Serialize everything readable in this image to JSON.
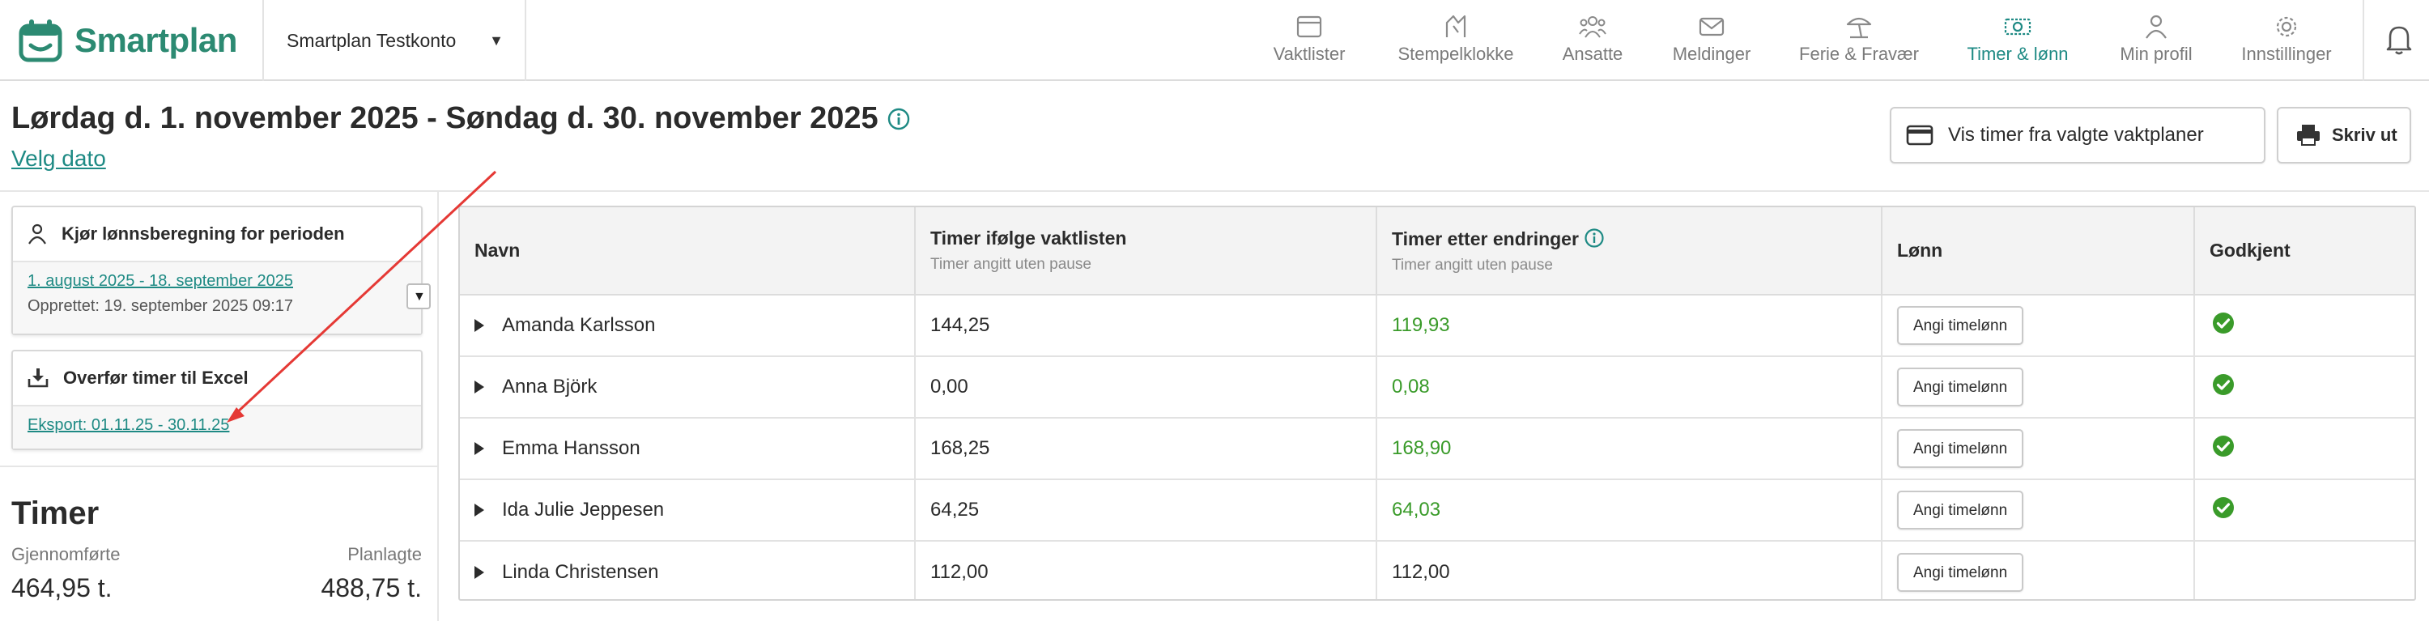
{
  "brand": {
    "name": "Smartplan",
    "color": "#2c8a72"
  },
  "account": {
    "name": "Smartplan Testkonto"
  },
  "nav": {
    "items": [
      {
        "label": "Vaktlister",
        "icon": "calendar-icon"
      },
      {
        "label": "Stempelklokke",
        "icon": "stamp-clock-icon"
      },
      {
        "label": "Ansatte",
        "icon": "people-icon"
      },
      {
        "label": "Meldinger",
        "icon": "envelope-icon"
      },
      {
        "label": "Ferie & Fravær",
        "icon": "beach-umbrella-icon"
      },
      {
        "label": "Timer & lønn",
        "icon": "money-icon"
      },
      {
        "label": "Min profil",
        "icon": "user-icon"
      },
      {
        "label": "Innstillinger",
        "icon": "gear-icon"
      }
    ],
    "active": "Timer & lønn",
    "active_color": "#1e8a84"
  },
  "header": {
    "title": "Lørdag d. 1. november 2025 - Søndag d. 30. november 2025",
    "velg_dato": "Velg dato",
    "vis_timer_button": "Vis timer fra valgte vaktplaner",
    "skriv_ut_button": "Skriv ut"
  },
  "left": {
    "payroll_card": {
      "title": "Kjør lønnsberegning for perioden",
      "period_link": "1. august 2025 - 18. september 2025",
      "created": "Opprettet: 19. september 2025 09:17"
    },
    "excel_card": {
      "title": "Overfør timer til Excel",
      "export_link": "Eksport: 01.11.25 - 30.11.25"
    },
    "timer": {
      "heading": "Timer",
      "completed_label": "Gjennomførte",
      "planned_label": "Planlagte",
      "completed_value": "464,95 t.",
      "planned_value": "488,75 t."
    }
  },
  "table": {
    "headers": {
      "name": "Navn",
      "planned": "Timer ifølge vaktlisten",
      "planned_sub": "Timer angitt uten pause",
      "changed": "Timer etter endringer",
      "changed_sub": "Timer angitt uten pause",
      "salary": "Lønn",
      "approved": "Godkjent"
    },
    "salary_button": "Angi timelønn",
    "rows": [
      {
        "name": "Amanda Karlsson",
        "planned": "144,25",
        "changed": "119,93",
        "changed_green": true,
        "approved": true
      },
      {
        "name": "Anna Björk",
        "planned": "0,00",
        "changed": "0,08",
        "changed_green": true,
        "approved": true
      },
      {
        "name": "Emma Hansson",
        "planned": "168,25",
        "changed": "168,90",
        "changed_green": true,
        "approved": true
      },
      {
        "name": "Ida Julie Jeppesen",
        "planned": "64,25",
        "changed": "64,03",
        "changed_green": true,
        "approved": true
      },
      {
        "name": "Linda Christensen",
        "planned": "112,00",
        "changed": "112,00",
        "changed_green": false,
        "approved": false
      }
    ]
  },
  "colors": {
    "accent": "#1e8a84",
    "green_value": "#3a9b2a",
    "approved_check": "#3a9b2a",
    "annotation_arrow": "#e53935"
  }
}
